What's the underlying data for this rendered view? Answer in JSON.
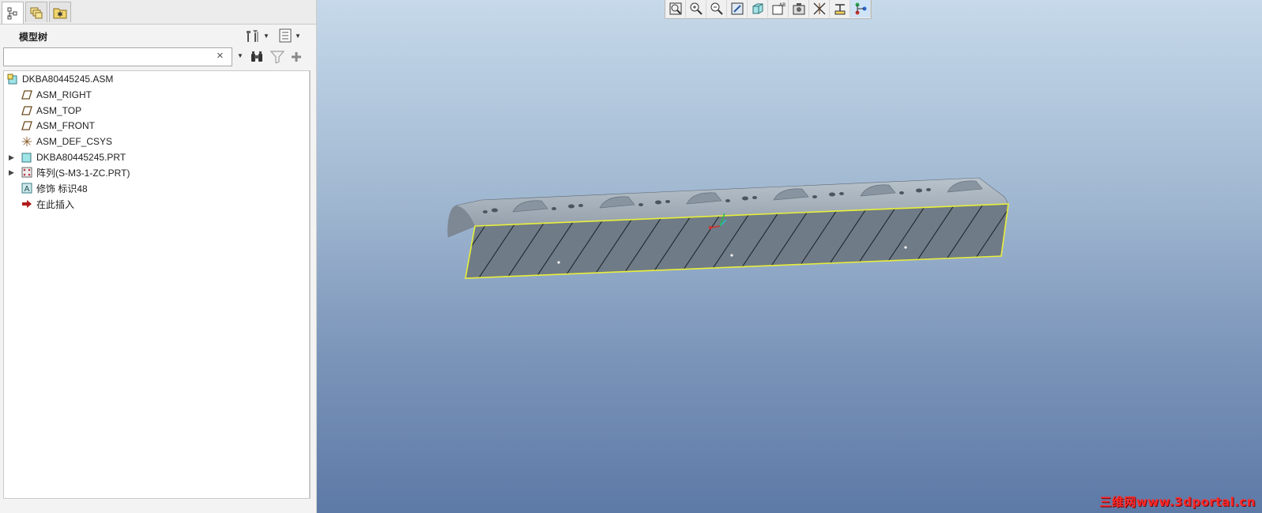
{
  "left_panel": {
    "tabs": [
      {
        "icon": "model-tree-icon"
      },
      {
        "icon": "layers-icon"
      },
      {
        "icon": "favorites-folder-icon"
      }
    ],
    "title": "模型树",
    "search": {
      "value": "",
      "clear_glyph": "×",
      "dropdown_glyph": "▼"
    },
    "tools": [
      "settings-icon",
      "tree-columns-icon",
      "find-binoculars-icon",
      "filter-icon",
      "add-icon"
    ],
    "tree": [
      {
        "label": "DKBA80445245.ASM",
        "icon": "assembly-icon",
        "expandable": false
      },
      {
        "label": "ASM_RIGHT",
        "icon": "datum-plane-icon",
        "expandable": false
      },
      {
        "label": "ASM_TOP",
        "icon": "datum-plane-icon",
        "expandable": false
      },
      {
        "label": "ASM_FRONT",
        "icon": "datum-plane-icon",
        "expandable": false
      },
      {
        "label": "ASM_DEF_CSYS",
        "icon": "coordinate-system-icon",
        "expandable": false
      },
      {
        "label": "DKBA80445245.PRT",
        "icon": "part-icon",
        "expandable": true
      },
      {
        "label": "阵列(S-M3-1-ZC.PRT)",
        "icon": "pattern-icon",
        "expandable": true
      },
      {
        "label": "修饰 标识48",
        "icon": "cosmetic-annotation-icon",
        "expandable": false
      },
      {
        "label": "在此插入",
        "icon": "insert-here-arrow-icon",
        "expandable": false
      }
    ]
  },
  "viewport": {
    "toolbar": [
      "refit-icon",
      "zoom-in-icon",
      "zoom-out-icon",
      "repaint-icon",
      "display-style-icon",
      "saved-views-icon",
      "view-manager-icon",
      "datum-display-icon",
      "annotation-display-icon",
      "spin-center-icon"
    ],
    "watermark": "三维网www.3dportal.cn"
  },
  "colors": {
    "viewport_top": "#c6d9ea",
    "viewport_bottom": "#5d79a6",
    "part_gray": "#6f7b87",
    "highlight_yellow": "#e8ef3a"
  }
}
